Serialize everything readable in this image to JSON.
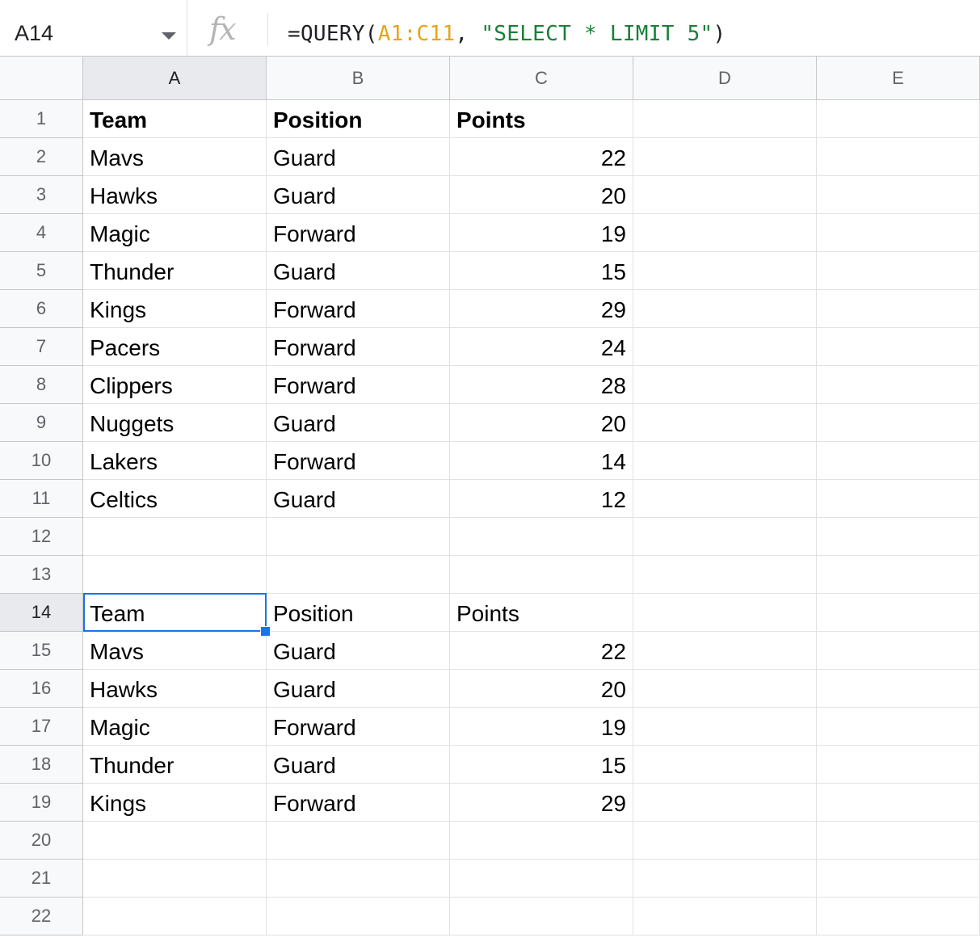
{
  "formula_bar": {
    "name_box": "A14",
    "fx_label": "fx",
    "formula_prefix": "=QUERY(",
    "formula_range": "A1:C11",
    "formula_sep": ", ",
    "formula_string": "\"SELECT * LIMIT 5\"",
    "formula_suffix": ")"
  },
  "columns": [
    "A",
    "B",
    "C",
    "D",
    "E"
  ],
  "rows": [
    {
      "num": "1",
      "a": "Team",
      "b": "Position",
      "c": "Points",
      "bold": true
    },
    {
      "num": "2",
      "a": "Mavs",
      "b": "Guard",
      "c": "22"
    },
    {
      "num": "3",
      "a": "Hawks",
      "b": "Guard",
      "c": "20"
    },
    {
      "num": "4",
      "a": "Magic",
      "b": "Forward",
      "c": "19"
    },
    {
      "num": "5",
      "a": "Thunder",
      "b": "Guard",
      "c": "15"
    },
    {
      "num": "6",
      "a": "Kings",
      "b": "Forward",
      "c": "29"
    },
    {
      "num": "7",
      "a": "Pacers",
      "b": "Forward",
      "c": "24"
    },
    {
      "num": "8",
      "a": "Clippers",
      "b": "Forward",
      "c": "28"
    },
    {
      "num": "9",
      "a": "Nuggets",
      "b": "Guard",
      "c": "20"
    },
    {
      "num": "10",
      "a": "Lakers",
      "b": "Forward",
      "c": "14"
    },
    {
      "num": "11",
      "a": "Celtics",
      "b": "Guard",
      "c": "12"
    },
    {
      "num": "12",
      "a": "",
      "b": "",
      "c": ""
    },
    {
      "num": "13",
      "a": "",
      "b": "",
      "c": ""
    },
    {
      "num": "14",
      "a": "Team",
      "b": "Position",
      "c": "Points",
      "text_c": true
    },
    {
      "num": "15",
      "a": "Mavs",
      "b": "Guard",
      "c": "22"
    },
    {
      "num": "16",
      "a": "Hawks",
      "b": "Guard",
      "c": "20"
    },
    {
      "num": "17",
      "a": "Magic",
      "b": "Forward",
      "c": "19"
    },
    {
      "num": "18",
      "a": "Thunder",
      "b": "Guard",
      "c": "15"
    },
    {
      "num": "19",
      "a": "Kings",
      "b": "Forward",
      "c": "29"
    },
    {
      "num": "20",
      "a": "",
      "b": "",
      "c": ""
    },
    {
      "num": "21",
      "a": "",
      "b": "",
      "c": ""
    },
    {
      "num": "22",
      "a": "",
      "b": "",
      "c": ""
    }
  ],
  "selection": {
    "cell": "A14",
    "row": "14",
    "column": "A"
  },
  "colors": {
    "selection": "#1a73e8",
    "range_ref": "#e8a317",
    "string_literal": "#188038"
  }
}
